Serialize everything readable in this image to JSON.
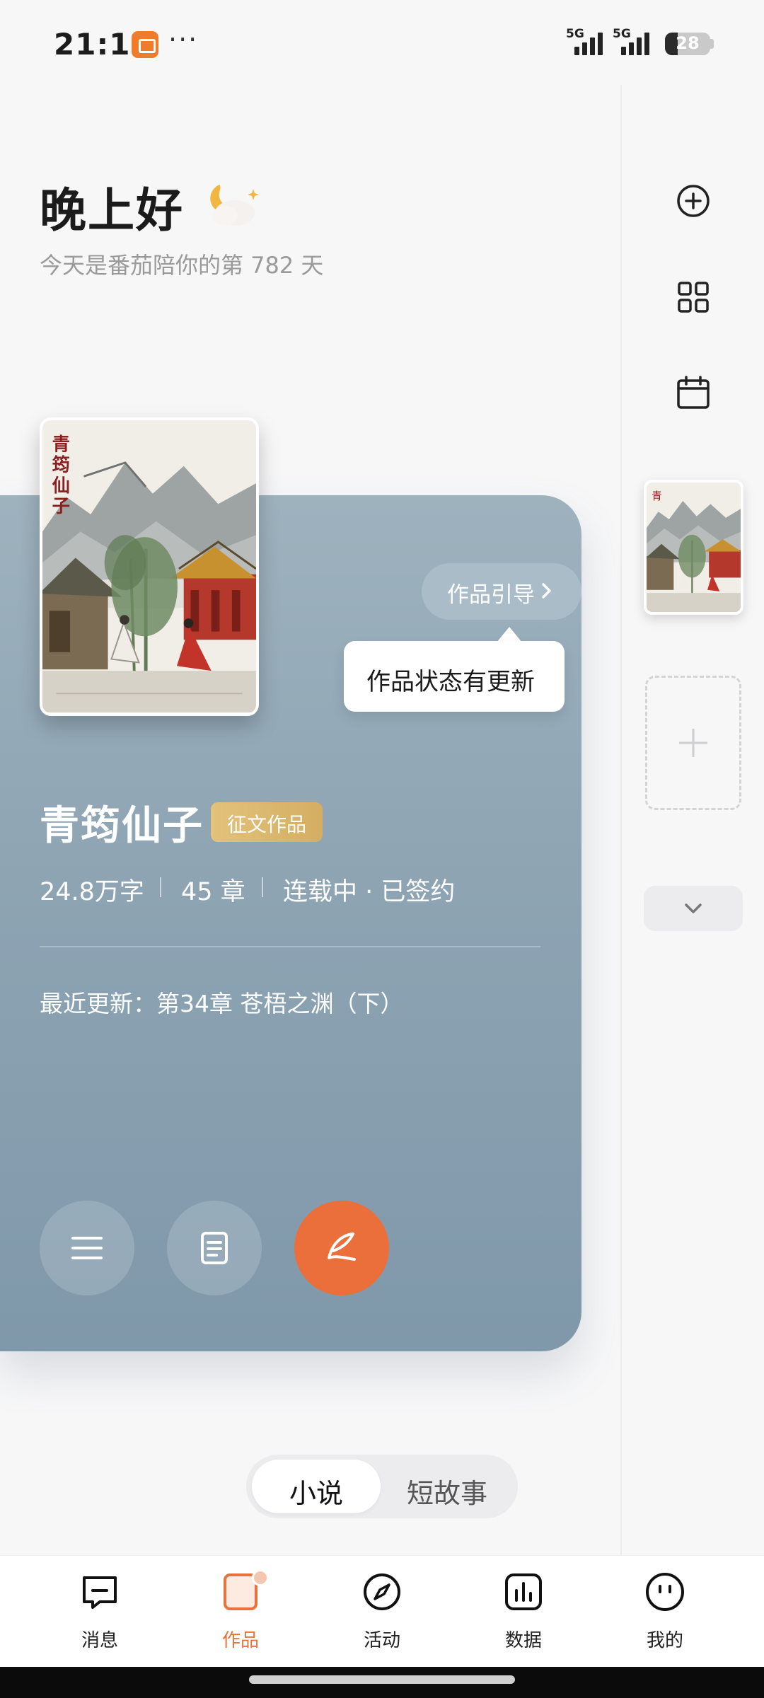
{
  "status_bar": {
    "time": "21:15",
    "more": "···",
    "signal_1": "5G",
    "signal_2": "5G",
    "battery": "28",
    "battery_level_percent": 28
  },
  "greeting": {
    "title": "晚上好",
    "subtitle": "今天是番茄陪你的第 782 天",
    "icon": "moon-cloud-icon"
  },
  "rail": {
    "icons": [
      "add-circle-icon",
      "grid-icon",
      "calendar-icon"
    ],
    "thumb_title": "青筠仙子"
  },
  "book": {
    "cover_title": "青筠仙子",
    "title": "青筠仙子",
    "badge": "征文作品",
    "words": "24.8万字",
    "chapters": "45 章",
    "status": "连载中 · 已签约",
    "latest": "最近更新：第34章 苍梧之渊（下）",
    "guide_label": "作品引导",
    "tooltip": "作品状态有更新"
  },
  "actions": [
    "menu-icon",
    "document-icon",
    "quill-icon"
  ],
  "segments": {
    "items": [
      "小说",
      "短故事"
    ],
    "active": "小说"
  },
  "nav": {
    "items": [
      {
        "label": "消息",
        "icon": "message-icon"
      },
      {
        "label": "作品",
        "icon": "works-icon"
      },
      {
        "label": "活动",
        "icon": "compass-icon"
      },
      {
        "label": "数据",
        "icon": "chart-icon"
      },
      {
        "label": "我的",
        "icon": "profile-icon"
      }
    ],
    "active": "作品"
  },
  "colors": {
    "accent": "#ea6f3a",
    "card": "#8ea4b3",
    "badge": "#d9b66a"
  }
}
